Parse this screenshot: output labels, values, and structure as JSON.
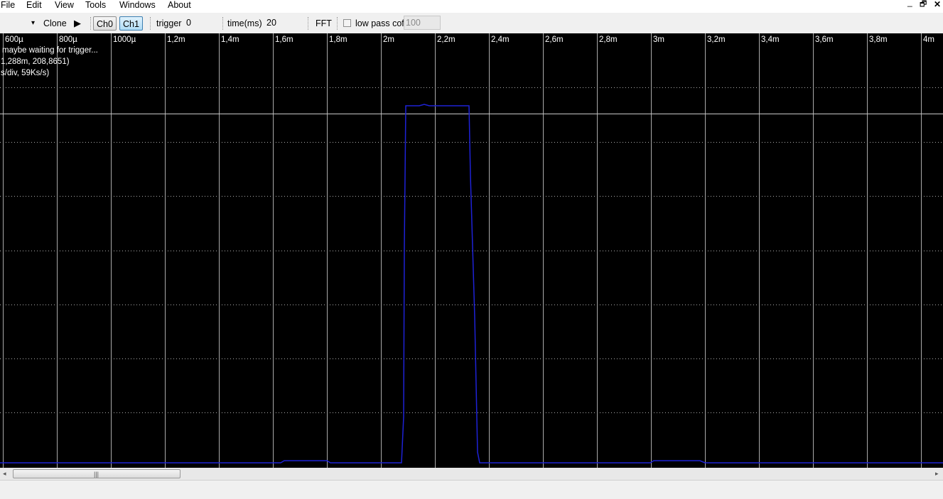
{
  "menu": {
    "file": "File",
    "edit": "Edit",
    "view": "View",
    "tools": "Tools",
    "windows": "Windows",
    "about": "About"
  },
  "window_controls": {
    "minimize": "_",
    "restore": "🗗",
    "close": "✕"
  },
  "toolbar": {
    "dropdown_arrow": "▾",
    "clone_label": "Clone",
    "run_icon": "▶",
    "ch0_label": "Ch0",
    "ch1_label": "Ch1",
    "trigger_label": "trigger",
    "trigger_value": "0",
    "time_label": "time(ms)",
    "time_value": "20",
    "fft_label": "FFT",
    "lowpass_label": "low pass cof",
    "lowpass_value": "100",
    "lowpass_checked": false,
    "ch1_active": true
  },
  "scope": {
    "status_line": "maybe waiting for trigger...",
    "cursor_readout": "1,288m, 208,8651)",
    "rate_readout": "s/div, 59Ks/s)",
    "trace_color": "#1e22d6",
    "grid_color": "#aaaaaa",
    "x_tick_labels": [
      "600µ",
      "800µ",
      "1000µ",
      "1,2m",
      "1,4m",
      "1,6m",
      "1,8m",
      "2m",
      "2,2m",
      "2,4m",
      "2,6m",
      "2,8m",
      "3m",
      "3,2m",
      "3,4m",
      "3,6m",
      "3,8m",
      "4m"
    ]
  },
  "scrollbar": {
    "thumb_fraction": 0.18
  }
}
